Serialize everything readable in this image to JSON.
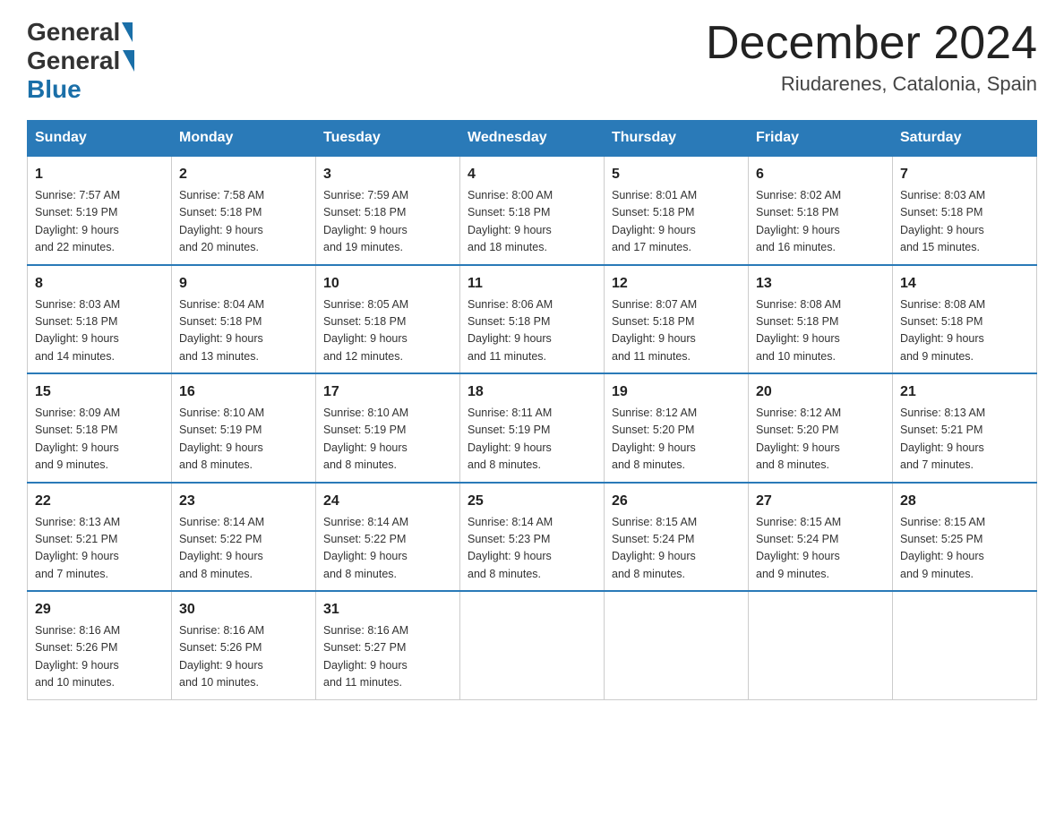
{
  "header": {
    "logo_general": "General",
    "logo_blue": "Blue",
    "month_title": "December 2024",
    "location": "Riudarenes, Catalonia, Spain"
  },
  "days_of_week": [
    "Sunday",
    "Monday",
    "Tuesday",
    "Wednesday",
    "Thursday",
    "Friday",
    "Saturday"
  ],
  "weeks": [
    [
      {
        "day": "1",
        "sunrise": "7:57 AM",
        "sunset": "5:19 PM",
        "daylight": "9 hours and 22 minutes."
      },
      {
        "day": "2",
        "sunrise": "7:58 AM",
        "sunset": "5:18 PM",
        "daylight": "9 hours and 20 minutes."
      },
      {
        "day": "3",
        "sunrise": "7:59 AM",
        "sunset": "5:18 PM",
        "daylight": "9 hours and 19 minutes."
      },
      {
        "day": "4",
        "sunrise": "8:00 AM",
        "sunset": "5:18 PM",
        "daylight": "9 hours and 18 minutes."
      },
      {
        "day": "5",
        "sunrise": "8:01 AM",
        "sunset": "5:18 PM",
        "daylight": "9 hours and 17 minutes."
      },
      {
        "day": "6",
        "sunrise": "8:02 AM",
        "sunset": "5:18 PM",
        "daylight": "9 hours and 16 minutes."
      },
      {
        "day": "7",
        "sunrise": "8:03 AM",
        "sunset": "5:18 PM",
        "daylight": "9 hours and 15 minutes."
      }
    ],
    [
      {
        "day": "8",
        "sunrise": "8:03 AM",
        "sunset": "5:18 PM",
        "daylight": "9 hours and 14 minutes."
      },
      {
        "day": "9",
        "sunrise": "8:04 AM",
        "sunset": "5:18 PM",
        "daylight": "9 hours and 13 minutes."
      },
      {
        "day": "10",
        "sunrise": "8:05 AM",
        "sunset": "5:18 PM",
        "daylight": "9 hours and 12 minutes."
      },
      {
        "day": "11",
        "sunrise": "8:06 AM",
        "sunset": "5:18 PM",
        "daylight": "9 hours and 11 minutes."
      },
      {
        "day": "12",
        "sunrise": "8:07 AM",
        "sunset": "5:18 PM",
        "daylight": "9 hours and 11 minutes."
      },
      {
        "day": "13",
        "sunrise": "8:08 AM",
        "sunset": "5:18 PM",
        "daylight": "9 hours and 10 minutes."
      },
      {
        "day": "14",
        "sunrise": "8:08 AM",
        "sunset": "5:18 PM",
        "daylight": "9 hours and 9 minutes."
      }
    ],
    [
      {
        "day": "15",
        "sunrise": "8:09 AM",
        "sunset": "5:18 PM",
        "daylight": "9 hours and 9 minutes."
      },
      {
        "day": "16",
        "sunrise": "8:10 AM",
        "sunset": "5:19 PM",
        "daylight": "9 hours and 8 minutes."
      },
      {
        "day": "17",
        "sunrise": "8:10 AM",
        "sunset": "5:19 PM",
        "daylight": "9 hours and 8 minutes."
      },
      {
        "day": "18",
        "sunrise": "8:11 AM",
        "sunset": "5:19 PM",
        "daylight": "9 hours and 8 minutes."
      },
      {
        "day": "19",
        "sunrise": "8:12 AM",
        "sunset": "5:20 PM",
        "daylight": "9 hours and 8 minutes."
      },
      {
        "day": "20",
        "sunrise": "8:12 AM",
        "sunset": "5:20 PM",
        "daylight": "9 hours and 8 minutes."
      },
      {
        "day": "21",
        "sunrise": "8:13 AM",
        "sunset": "5:21 PM",
        "daylight": "9 hours and 7 minutes."
      }
    ],
    [
      {
        "day": "22",
        "sunrise": "8:13 AM",
        "sunset": "5:21 PM",
        "daylight": "9 hours and 7 minutes."
      },
      {
        "day": "23",
        "sunrise": "8:14 AM",
        "sunset": "5:22 PM",
        "daylight": "9 hours and 8 minutes."
      },
      {
        "day": "24",
        "sunrise": "8:14 AM",
        "sunset": "5:22 PM",
        "daylight": "9 hours and 8 minutes."
      },
      {
        "day": "25",
        "sunrise": "8:14 AM",
        "sunset": "5:23 PM",
        "daylight": "9 hours and 8 minutes."
      },
      {
        "day": "26",
        "sunrise": "8:15 AM",
        "sunset": "5:24 PM",
        "daylight": "9 hours and 8 minutes."
      },
      {
        "day": "27",
        "sunrise": "8:15 AM",
        "sunset": "5:24 PM",
        "daylight": "9 hours and 9 minutes."
      },
      {
        "day": "28",
        "sunrise": "8:15 AM",
        "sunset": "5:25 PM",
        "daylight": "9 hours and 9 minutes."
      }
    ],
    [
      {
        "day": "29",
        "sunrise": "8:16 AM",
        "sunset": "5:26 PM",
        "daylight": "9 hours and 10 minutes."
      },
      {
        "day": "30",
        "sunrise": "8:16 AM",
        "sunset": "5:26 PM",
        "daylight": "9 hours and 10 minutes."
      },
      {
        "day": "31",
        "sunrise": "8:16 AM",
        "sunset": "5:27 PM",
        "daylight": "9 hours and 11 minutes."
      },
      null,
      null,
      null,
      null
    ]
  ],
  "labels": {
    "sunrise_prefix": "Sunrise: ",
    "sunset_prefix": "Sunset: ",
    "daylight_prefix": "Daylight: "
  }
}
